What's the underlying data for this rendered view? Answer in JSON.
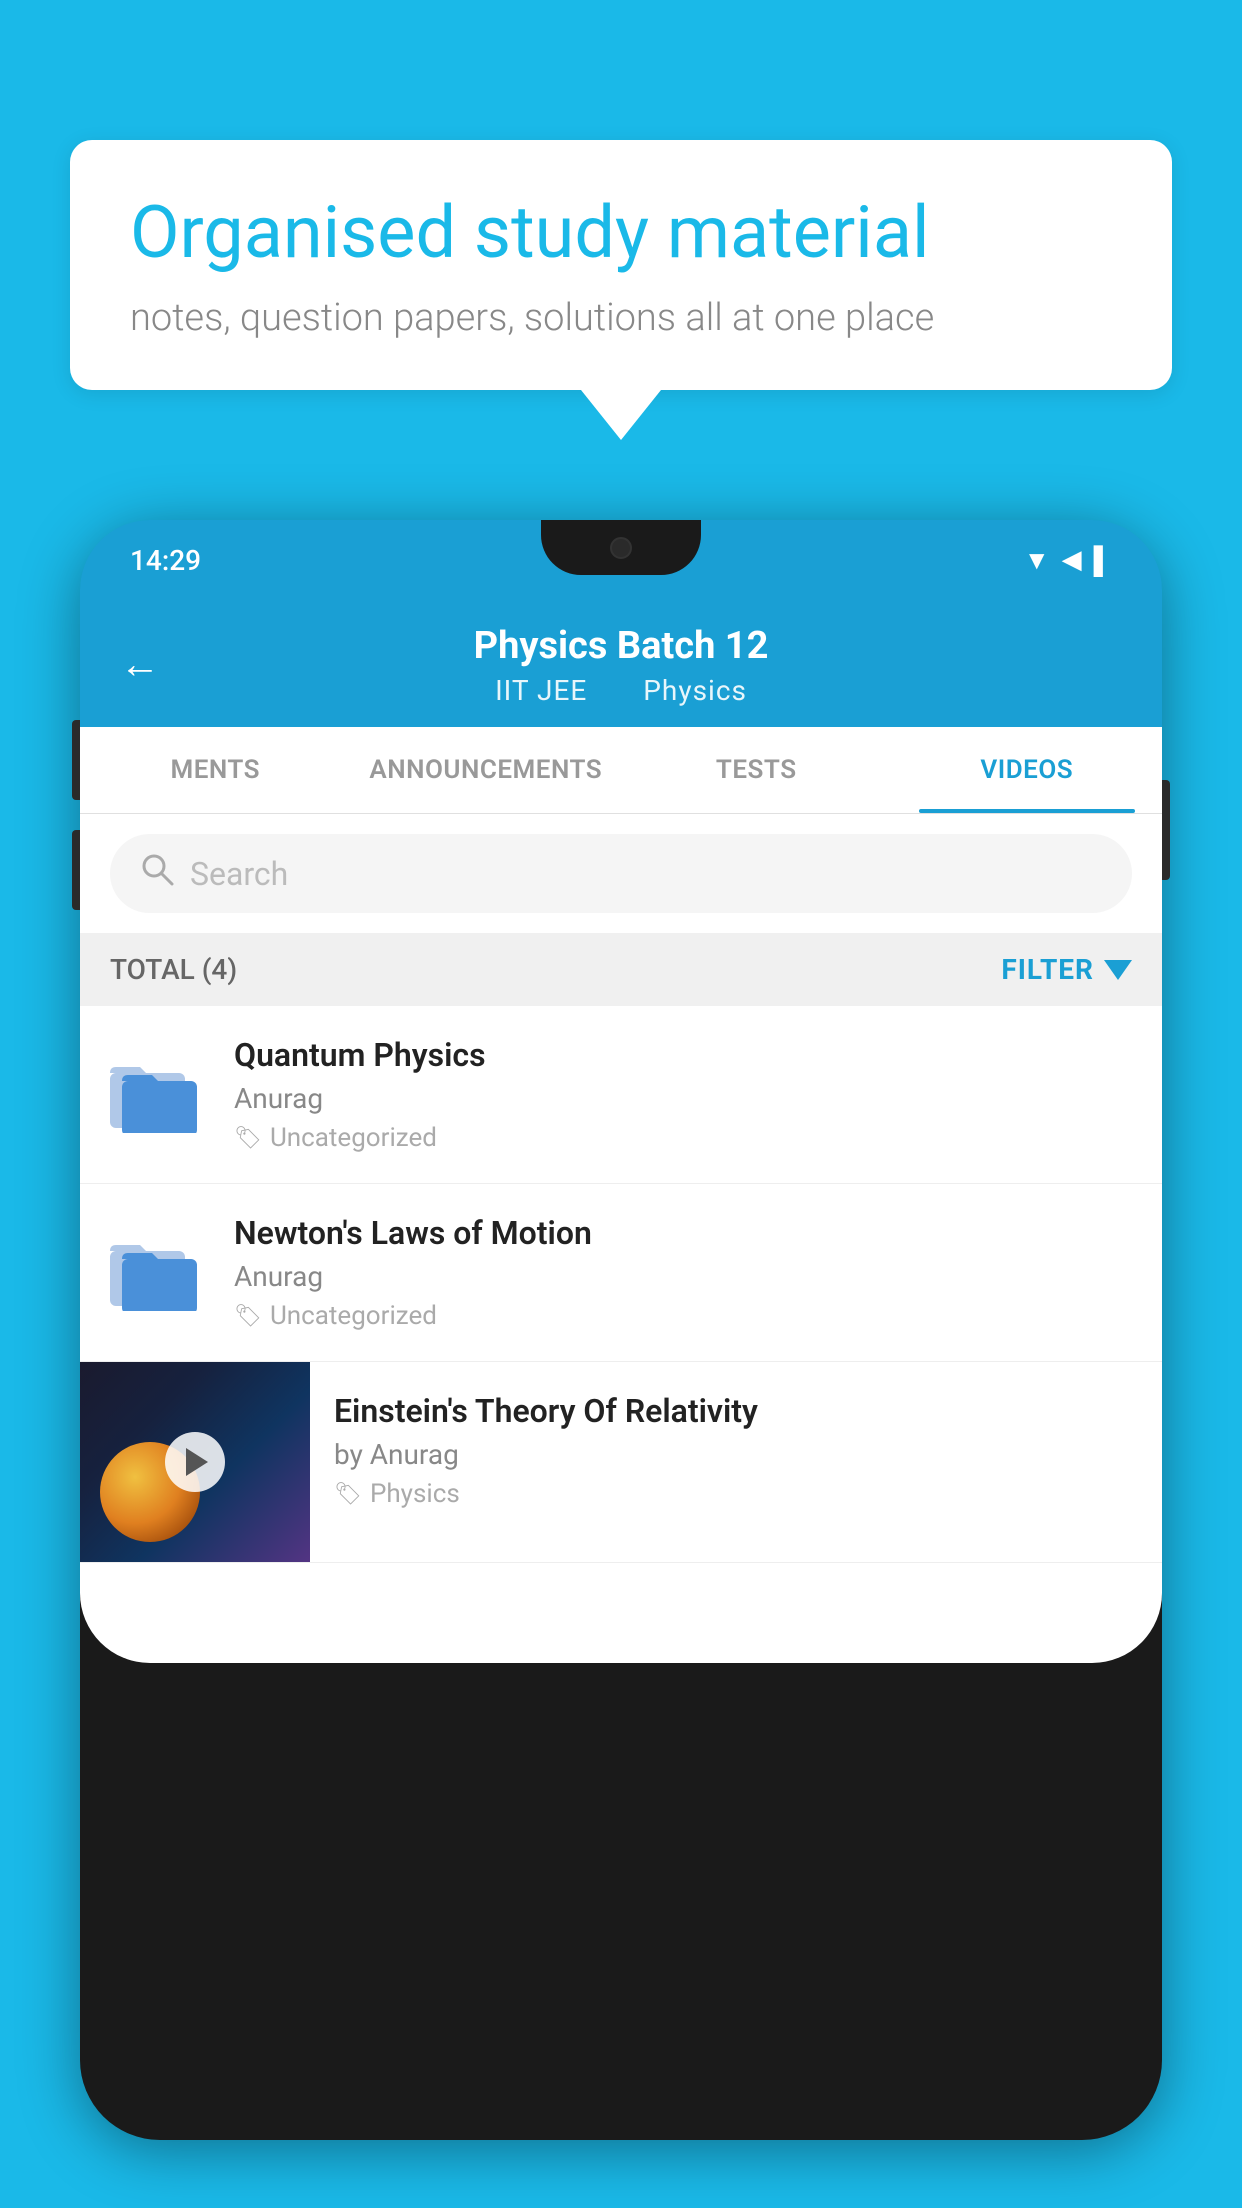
{
  "background_color": "#1ab9e8",
  "speech_bubble": {
    "title": "Organised study material",
    "subtitle": "notes, question papers, solutions all at one place"
  },
  "phone": {
    "status_bar": {
      "time": "14:29"
    },
    "header": {
      "back_label": "←",
      "title": "Physics Batch 12",
      "subtitle_left": "IIT JEE",
      "subtitle_right": "Physics"
    },
    "tabs": [
      {
        "label": "MENTS",
        "active": false
      },
      {
        "label": "ANNOUNCEMENTS",
        "active": false
      },
      {
        "label": "TESTS",
        "active": false
      },
      {
        "label": "VIDEOS",
        "active": true
      }
    ],
    "search": {
      "placeholder": "Search"
    },
    "filter_bar": {
      "total_label": "TOTAL (4)",
      "filter_label": "FILTER"
    },
    "videos": [
      {
        "id": 1,
        "title": "Quantum Physics",
        "author": "Anurag",
        "tag": "Uncategorized",
        "has_thumbnail": false
      },
      {
        "id": 2,
        "title": "Newton's Laws of Motion",
        "author": "Anurag",
        "tag": "Uncategorized",
        "has_thumbnail": false
      },
      {
        "id": 3,
        "title": "Einstein's Theory Of Relativity",
        "author": "by Anurag",
        "tag": "Physics",
        "has_thumbnail": true
      }
    ]
  }
}
